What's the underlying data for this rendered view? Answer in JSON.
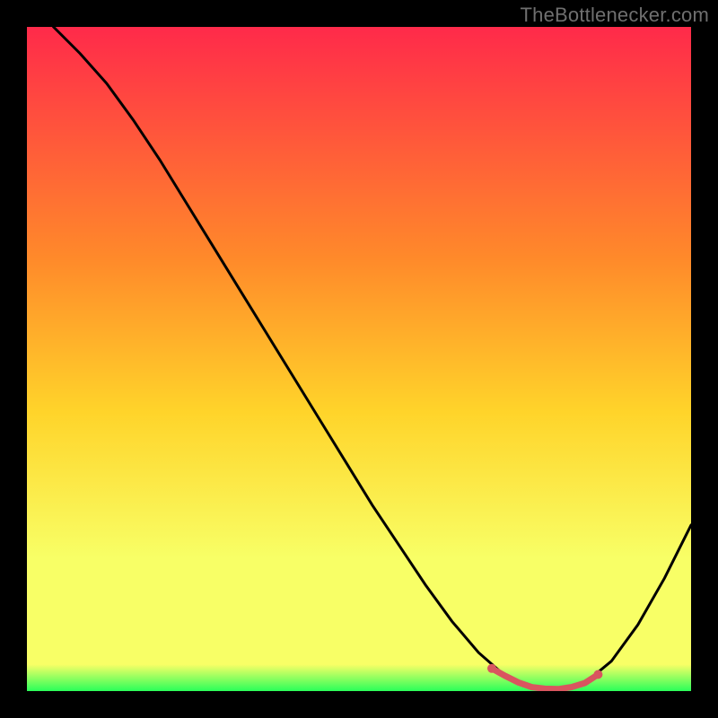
{
  "attribution": "TheBottlenecker.com",
  "colors": {
    "bg": "#000000",
    "gradient_top": "#ff2a4a",
    "gradient_upper_mid": "#ff8a2a",
    "gradient_mid": "#ffd42a",
    "gradient_lower_mid": "#f8ff66",
    "gradient_bottom": "#2aff5a",
    "curve": "#000000",
    "accent_segment": "#d9555f",
    "attribution_text": "#6f6f6f"
  },
  "chart_data": {
    "type": "line",
    "title": "",
    "xlabel": "",
    "ylabel": "",
    "xlim": [
      0,
      100
    ],
    "ylim": [
      0,
      100
    ],
    "series": [
      {
        "name": "bottleneck-curve",
        "x": [
          4,
          8,
          12,
          16,
          20,
          24,
          28,
          32,
          36,
          40,
          44,
          48,
          52,
          56,
          60,
          64,
          68,
          72,
          76,
          80,
          84,
          88,
          92,
          96,
          100
        ],
        "y": [
          100,
          96,
          91.5,
          86,
          80,
          73.5,
          67,
          60.5,
          54,
          47.5,
          41,
          34.5,
          28,
          22,
          16,
          10.5,
          5.8,
          2.3,
          0.6,
          0.3,
          1.2,
          4.5,
          10,
          17,
          25
        ]
      }
    ],
    "accent_segment": {
      "name": "optimal-range",
      "x": [
        70,
        72,
        74,
        76,
        78,
        80,
        82,
        84,
        86
      ],
      "y": [
        3.4,
        2.3,
        1.3,
        0.6,
        0.35,
        0.3,
        0.6,
        1.2,
        2.5
      ]
    },
    "gradient_stops_pct": [
      0,
      35,
      58,
      80,
      96,
      100
    ],
    "notes": "Axes have no visible tick labels or titles in the source image; values are in percent of plot area. Curve y-values estimated from pixel positions."
  }
}
